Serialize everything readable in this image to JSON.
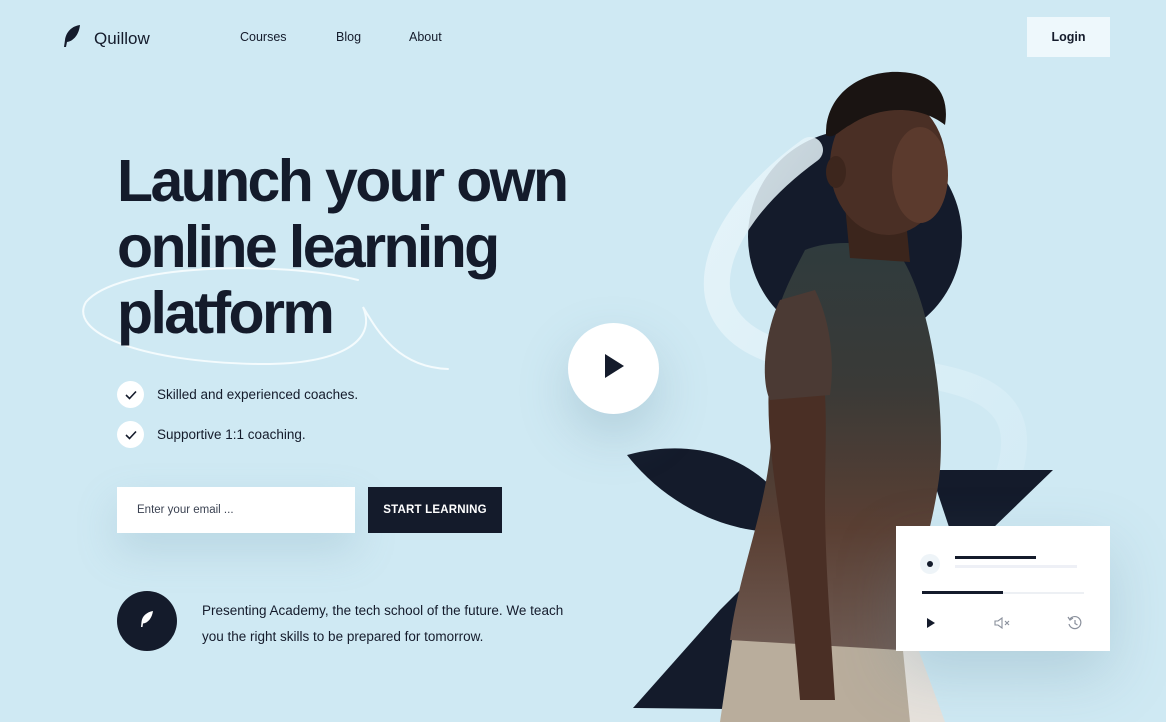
{
  "nav": {
    "brand": "Quillow",
    "links": [
      "Courses",
      "Blog",
      "About"
    ],
    "login_label": "Login"
  },
  "hero": {
    "title_lines": [
      "Launch your own",
      "online learning",
      "platform"
    ],
    "features": [
      "Skilled and experienced coaches.",
      "Supportive 1:1 coaching."
    ],
    "email_placeholder": "Enter your email ...",
    "cta_label": "START LEARNING",
    "academy_text": "Presenting Academy, the tech school of the future. We teach you the right skills to be prepared for tomorrow."
  },
  "player": {
    "progress": 0.5
  },
  "colors": {
    "background": "#cfe9f3",
    "dark": "#141b2b",
    "white": "#ffffff"
  },
  "icons": {
    "brand": "feather-icon",
    "check": "check-icon",
    "play": "play-icon",
    "mute": "mute-icon",
    "replay": "history-icon"
  }
}
